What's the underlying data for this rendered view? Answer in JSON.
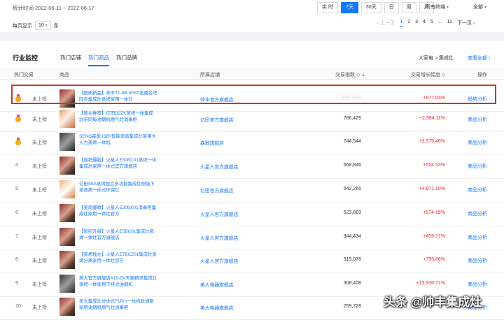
{
  "toolbar": {
    "stat_range": "统计时间 2022-06-11 ~ 2022-06-17",
    "range_buttons": [
      "实 时",
      "7天",
      "30天",
      "日",
      "周",
      "月"
    ],
    "active_range": "7天",
    "terminal_select": "所有终端",
    "scope_select": "全部"
  },
  "pagination": {
    "per_page_label": "每页显示",
    "per_page_value": "10",
    "per_page_unit": "条",
    "prev": "‹ 上一页",
    "pages": [
      "1",
      "2",
      "3",
      "4",
      "5",
      "...",
      "11"
    ],
    "current_page": "1",
    "next": "下一页 ›"
  },
  "section": {
    "title": "行业监控",
    "tabs": [
      "热门店铺",
      "热门商品",
      "热门品牌"
    ],
    "active_tab": "热门商品",
    "category": "大家电 > 集成灶",
    "more": "查看全部 ›"
  },
  "table": {
    "headers": {
      "hot_deal": "热门交易",
      "product": "商品",
      "shop": "所属店铺",
      "index": "交易指数 ◇ ⇣",
      "growth": "交易增长幅度 ◇",
      "action": "操作"
    },
    "rows": [
      {
        "rank": "1",
        "status": "未上榜",
        "name": "【颜质新品】帅丰T1-8B-90ST发嘉名烤同步集成灶蒸烤家用一体灶",
        "shop": "帅丰官方旗舰店",
        "index": "1,200,966",
        "growth": "+877.03%",
        "action": "趋势分析"
      },
      {
        "rank": "2",
        "status": "未上榜",
        "name": "【蒸主推荐】亿田D2ZK蒸烤一体集成灶带同每油烟机燃气灶消毒柜",
        "shop": "亿田官方旗舰店",
        "index": "786,425",
        "growth": "+2,984.11%",
        "action": "商品分析"
      },
      {
        "rank": "3",
        "status": "未上榜",
        "name": "SENG森歌 I3ZK智能语音集成灶家用大火力蒸烤一体机",
        "shop": "森歌旗舰店",
        "index": "744,544",
        "growth": "+3,975.46%",
        "action": "商品分析"
      },
      {
        "rank": "4",
        "status": "未上榜",
        "name": "【热销爆款】火星人E30BC01蒸烤一体集成灶家用一体式官方旗舰店",
        "shop": "火星人官方旗舰店",
        "index": "668,846",
        "growth": "+554.53%",
        "action": "商品分析"
      },
      {
        "rank": "5",
        "status": "未上榜",
        "name": "亿田S5A蒸烤独立多功能集成灶侧吸下排蒸烤一体式环保灶",
        "shop": "亿田官方旗舰店",
        "index": "542,265",
        "growth": "+4,871.10%",
        "action": "商品分析"
      },
      {
        "rank": "6",
        "status": "未上榜",
        "name": "【美商爆款】火星人E30BX01消毒柜集成灶家用一体灶官方",
        "shop": "火星人官方旗舰店",
        "index": "523,883",
        "growth": "+574.15%",
        "action": "商品分析"
      },
      {
        "rank": "7",
        "status": "未上榜",
        "name": "【智控升级】火星人E5BC01集成灶蒸烤一体灶官方旗舰店",
        "shop": "火星人官方旗舰店",
        "index": "344,434",
        "growth": "+459.71%",
        "action": "商品分析"
      },
      {
        "rank": "8",
        "status": "未上榜",
        "name": "【蒸烤独立】火星人E7BCZ01集成灶蒸烤分离家用一体灶官方",
        "shop": "火星人官方旗舰店",
        "index": "315,078",
        "growth": "+795.86%",
        "action": "商品分析"
      },
      {
        "rank": "9",
        "status": "未上榜",
        "name": "美大官方旗舰店X10-ZK天猫精灵集成灶蒸烤一体家用下排式油烟机",
        "shop": "美大电器旗舰店",
        "index": "308,408",
        "growth": "+13,936.71%",
        "action": "商品分析"
      },
      {
        "rank": "10",
        "status": "未上榜",
        "name": "美大集成灶分体式F1Pro一体机政道限家用油烟机燃气灶消毒柜",
        "shop": "美大电器旗舰店",
        "index": "259,728",
        "growth": "",
        "action": "商品分析"
      }
    ]
  },
  "watermark": "头条 @帅丰集成灶"
}
